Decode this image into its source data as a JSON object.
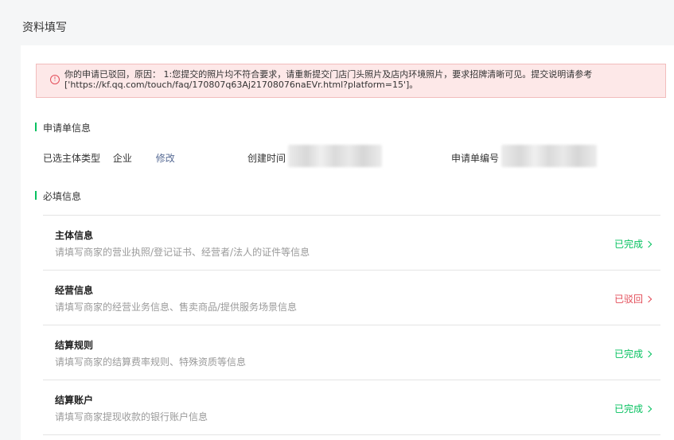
{
  "page": {
    "title": "资料填写"
  },
  "alert": {
    "icon": "alert-circle-icon",
    "text": "你的申请已驳回，原因：  1:您提交的照片均不符合要求，请重新提交门店门头照片及店内环境照片，要求招牌清晰可见。提交说明请参考\n['https://kf.qq.com/touch/faq/170807q63Aj21708076naEVr.html?platform=15']。"
  },
  "application_info": {
    "section_title": "申请单信息",
    "subject_type_label": "已选主体类型",
    "subject_type_value": "企业",
    "modify_link": "修改",
    "created_time_label": "创建时间",
    "application_no_label": "申请单编号"
  },
  "required_info": {
    "section_title": "必填信息",
    "items": [
      {
        "title": "主体信息",
        "desc": "请填写商家的营业执照/登记证书、经营者/法人的证件等信息",
        "status": "已完成"
      },
      {
        "title": "经营信息",
        "desc": "请填写商家的经营业务信息、售卖商品/提供服务场景信息",
        "status": "已驳回"
      },
      {
        "title": "结算规则",
        "desc": "请填写商家的结算费率规则、特殊资质等信息",
        "status": "已完成"
      },
      {
        "title": "结算账户",
        "desc": "请填写商家提现收款的银行账户信息",
        "status": "已完成"
      }
    ]
  },
  "colors": {
    "success": "#07c160",
    "error": "#e34d59",
    "link": "#576b95",
    "alert_bg": "#fde8e8"
  }
}
